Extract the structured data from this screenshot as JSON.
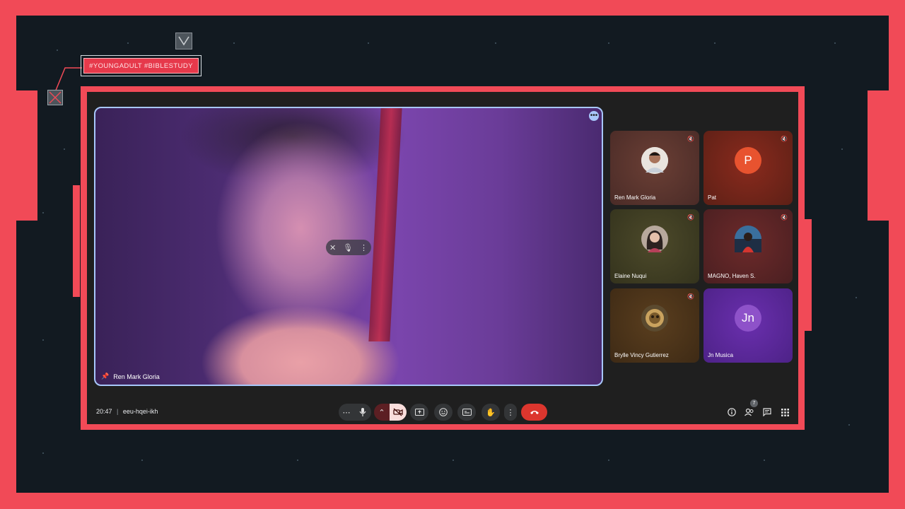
{
  "overlay": {
    "hashtag_banner": "#YOUNGADULT #BIBLESTUDY",
    "badge_glyph": "V"
  },
  "colors": {
    "frame_accent": "#f14a57",
    "stage_background": "#121a21",
    "meet_background": "#1f1f1f",
    "active_speaker_border": "#a8c7fa",
    "end_call_red": "#dc362e"
  },
  "main_video": {
    "participant_name": "Ren Mark Gloria",
    "more_options_icon": "more-dots-icon",
    "pin_icon": "pin-icon"
  },
  "participants": [
    {
      "name": "Ren Mark Gloria",
      "avatar_type": "photo",
      "muted": true
    },
    {
      "name": "Pat",
      "avatar_initials": "P",
      "avatar_color": "#e8532f",
      "muted": true
    },
    {
      "name": "Elaine Nuqui",
      "avatar_type": "photo",
      "muted": true
    },
    {
      "name": "MAGNO, Haven S.",
      "avatar_type": "photo",
      "muted": true
    },
    {
      "name": "Brylle Vincy Gutierrez",
      "avatar_type": "photo",
      "muted": true
    },
    {
      "name": "Jn Musica",
      "avatar_initials": "Jn",
      "avatar_color": "#8e52c9",
      "muted": false
    }
  ],
  "bottom_bar": {
    "time": "20:47",
    "separator": "|",
    "meeting_code": "eeu-hqei-ikh",
    "controls": [
      "more-dots-icon",
      "microphone-icon",
      "chevron-up-icon",
      "camera-off-icon",
      "present-icon",
      "emoji-icon",
      "captions-icon",
      "raise-hand-icon",
      "more-vert-icon",
      "end-call-icon"
    ],
    "right_controls": [
      "info-icon",
      "people-icon",
      "chat-icon",
      "activities-icon"
    ],
    "people_count": "7"
  }
}
